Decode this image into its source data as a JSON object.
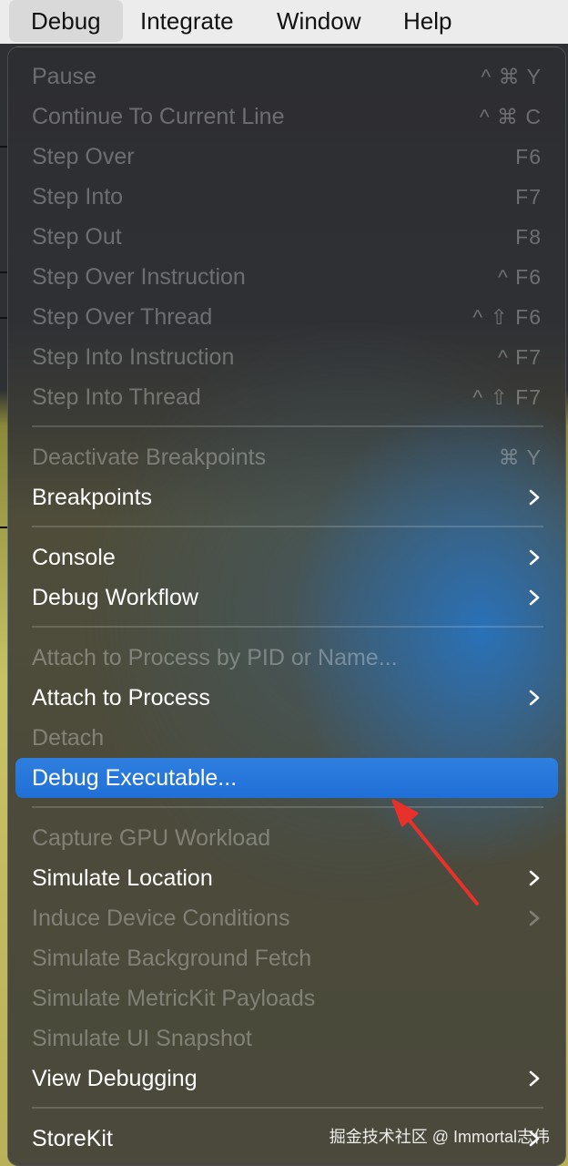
{
  "menubar": {
    "items": [
      "Debug",
      "Integrate",
      "Window",
      "Help"
    ]
  },
  "menu": {
    "items": [
      {
        "label": "Pause",
        "shortcut": "^ ⌘ Y",
        "enabled": false
      },
      {
        "label": "Continue To Current Line",
        "shortcut": "^ ⌘ C",
        "enabled": false
      },
      {
        "label": "Step Over",
        "shortcut": "F6",
        "enabled": false
      },
      {
        "label": "Step Into",
        "shortcut": "F7",
        "enabled": false
      },
      {
        "label": "Step Out",
        "shortcut": "F8",
        "enabled": false
      },
      {
        "label": "Step Over Instruction",
        "shortcut": "^ F6",
        "enabled": false
      },
      {
        "label": "Step Over Thread",
        "shortcut": "^ ⇧ F6",
        "enabled": false
      },
      {
        "label": "Step Into Instruction",
        "shortcut": "^ F7",
        "enabled": false
      },
      {
        "label": "Step Into Thread",
        "shortcut": "^ ⇧ F7",
        "enabled": false
      },
      {
        "label": "Deactivate Breakpoints",
        "shortcut": "⌘ Y",
        "enabled": false
      },
      {
        "label": "Breakpoints",
        "submenu": true,
        "enabled": true
      },
      {
        "label": "Console",
        "submenu": true,
        "enabled": true
      },
      {
        "label": "Debug Workflow",
        "submenu": true,
        "enabled": true
      },
      {
        "label": "Attach to Process by PID or Name...",
        "enabled": false
      },
      {
        "label": "Attach to Process",
        "submenu": true,
        "enabled": true
      },
      {
        "label": "Detach",
        "enabled": false
      },
      {
        "label": "Debug Executable...",
        "enabled": true,
        "highlighted": true
      },
      {
        "label": "Capture GPU Workload",
        "enabled": false
      },
      {
        "label": "Simulate Location",
        "submenu": true,
        "enabled": true
      },
      {
        "label": "Induce Device Conditions",
        "submenu": true,
        "enabled": false
      },
      {
        "label": "Simulate Background Fetch",
        "enabled": false
      },
      {
        "label": "Simulate MetricKit Payloads",
        "enabled": false
      },
      {
        "label": "Simulate UI Snapshot",
        "enabled": false
      },
      {
        "label": "View Debugging",
        "submenu": true,
        "enabled": true
      },
      {
        "label": "StoreKit",
        "submenu": true,
        "enabled": true
      }
    ]
  },
  "watermark": "掘金技术社区 @ Immortal志伟",
  "colors": {
    "highlight": "#1f6fd6",
    "annotation_arrow": "#e8312b"
  },
  "icons": {
    "submenu": "chevron-right-icon"
  }
}
